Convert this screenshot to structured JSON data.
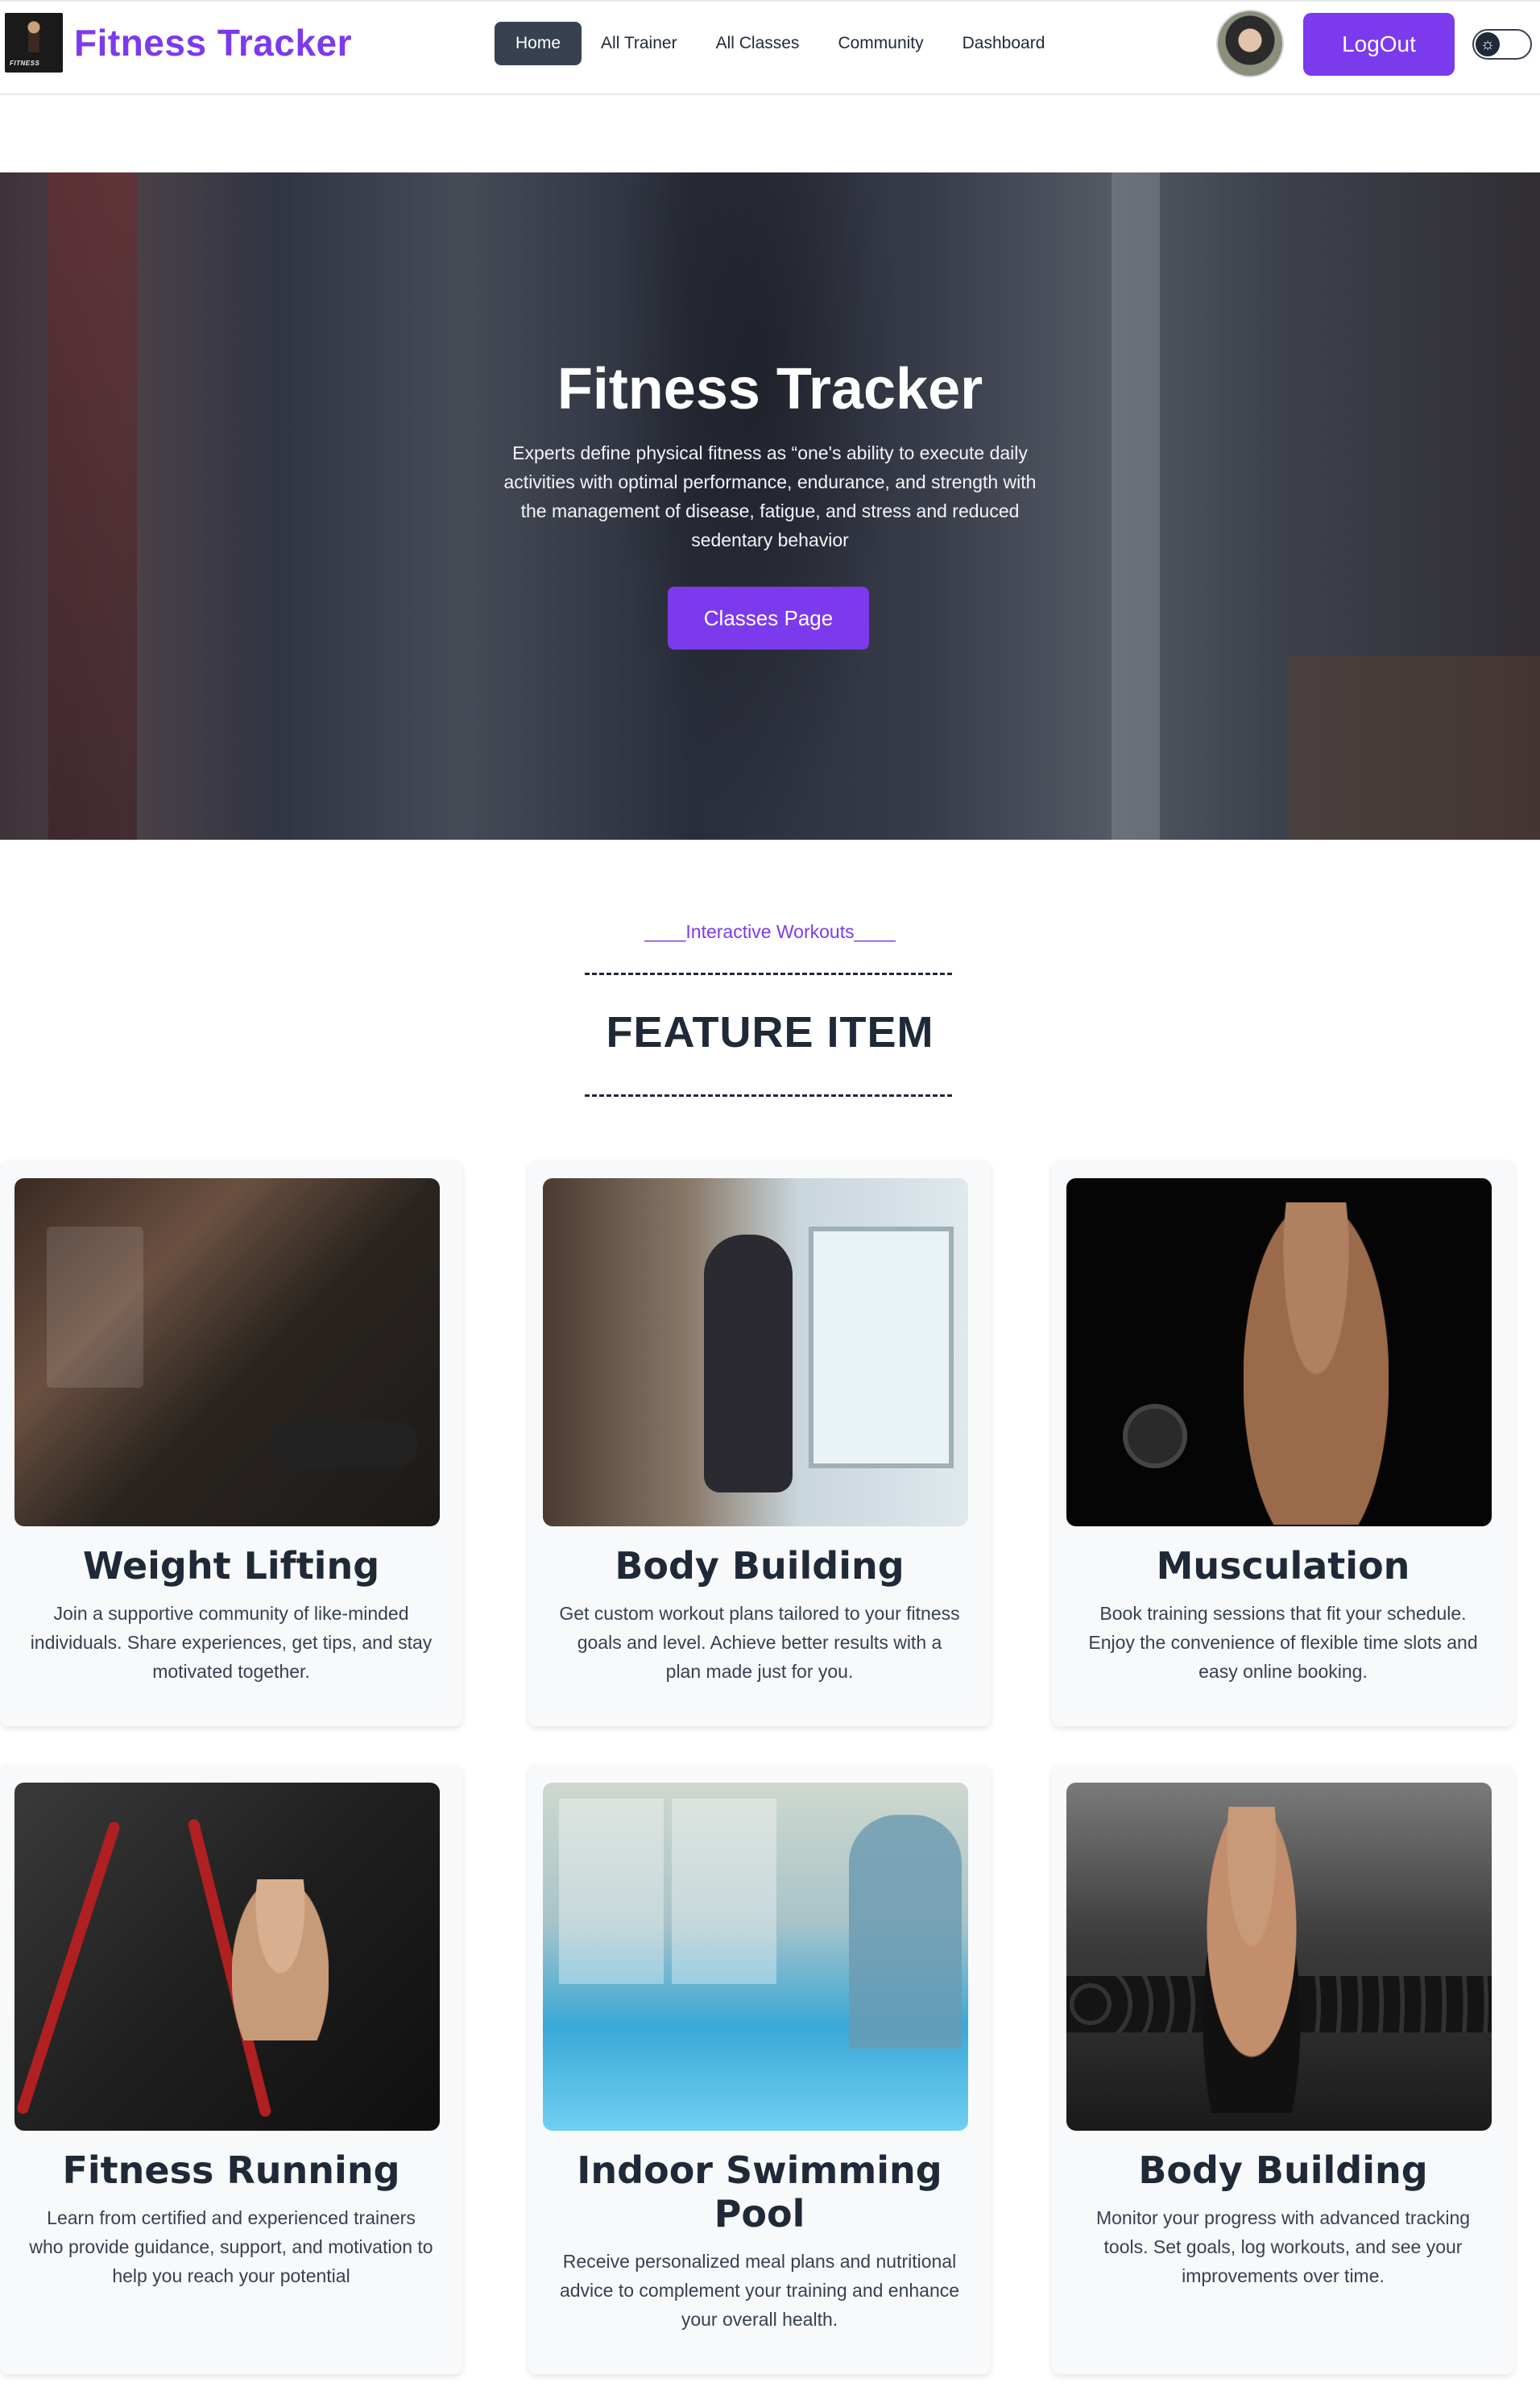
{
  "navbar": {
    "brand_title": "Fitness Tracker",
    "logo_word": "FITNESS",
    "links": [
      "Home",
      "All Trainer",
      "All Classes",
      "Community",
      "Dashboard"
    ],
    "active_link": "Home",
    "logout_label": "LogOut",
    "theme_icon": "sun-icon"
  },
  "hero": {
    "title": "Fitness Tracker",
    "description": "Experts define physical fitness as “one's ability to execute daily activities with optimal performance, endurance, and strength with the management of disease, fatigue, and stress and reduced sedentary behavior",
    "button_label": "Classes Page"
  },
  "features": {
    "eyebrow": "____Interactive Workouts____",
    "title": "FEATURE ITEM",
    "cards": [
      {
        "title": "Weight Lifting",
        "description": "Join a supportive community of like-minded individuals. Share experiences, get tips, and stay motivated together."
      },
      {
        "title": "Body Building",
        "description": "Get custom workout plans tailored to your fitness goals and level. Achieve better results with a plan made just for you."
      },
      {
        "title": "Musculation",
        "description": "Book training sessions that fit your schedule. Enjoy the convenience of flexible time slots and easy online booking."
      },
      {
        "title": "Fitness Running",
        "description": "Learn from certified and experienced trainers who provide guidance, support, and motivation to help you reach your potential"
      },
      {
        "title": "Indoor Swimming Pool",
        "description": "Receive personalized meal plans and nutritional advice to complement your training and enhance your overall health."
      },
      {
        "title": "Body Building",
        "description": "Monitor your progress with advanced tracking tools. Set goals, log workouts, and see your improvements over time."
      }
    ]
  },
  "colors": {
    "accent": "#7c3aed",
    "nav_active_bg": "#374151",
    "card_bg": "#f8f9fa"
  }
}
